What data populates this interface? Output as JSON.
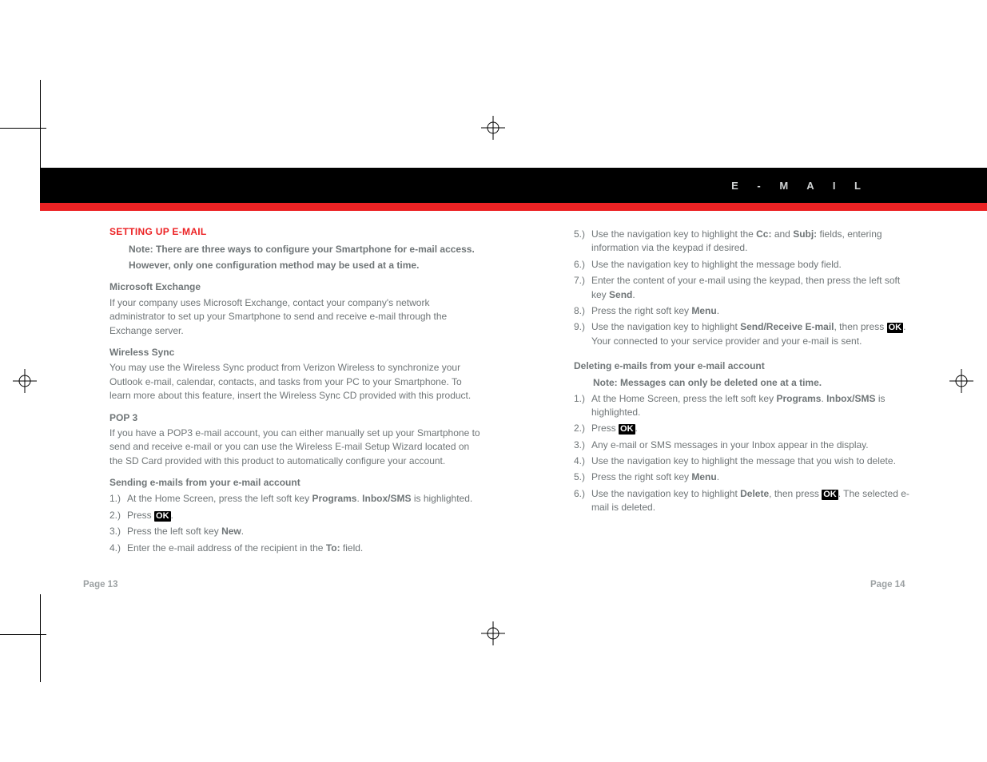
{
  "header": {
    "title": "E - M A I L"
  },
  "left": {
    "title": "SETTING UP E-MAIL",
    "note1": "Note: There are three ways to configure your Smartphone for e-mail access.",
    "note2": "However, only one configuration method may be used at a time.",
    "ms_h": "Microsoft Exchange",
    "ms_p": "If your company uses Microsoft Exchange, contact your company's network administrator to set up your Smartphone to send and receive e-mail through the Exchange server.",
    "ws_h": "Wireless Sync",
    "ws_p": "You may use the Wireless Sync product from Verizon Wireless to synchronize your Outlook e-mail, calendar, contacts, and tasks from your PC to your Smartphone. To learn more about this feature, insert the Wireless Sync CD provided with this product.",
    "pop_h": "POP 3",
    "pop_p": "If you have a POP3 e-mail account, you can either manually set up your Smartphone to send and receive e-mail or you can use the Wireless E-mail Setup Wizard located on the SD Card provided with this product to automatically configure your account.",
    "send_h": "Sending e-mails from your e-mail account",
    "s1n": "1.)",
    "s1a": "At the Home Screen, press the left soft key ",
    "s1b": "Programs",
    "s1c": ". ",
    "s1d": "Inbox/SMS",
    "s1e": " is highlighted.",
    "s2n": "2.)",
    "s2a": "Press ",
    "s2c": ".",
    "s3n": "3.)",
    "s3a": "Press the left soft key ",
    "s3b": "New",
    "s3c": ".",
    "s4n": "4.)",
    "s4a": "Enter the e-mail address of the recipient in the ",
    "s4b": "To:",
    "s4c": " field."
  },
  "right": {
    "s5n": "5.)",
    "s5a": "Use the navigation key to highlight the ",
    "s5b": "Cc:",
    "s5c": " and ",
    "s5d": "Subj:",
    "s5e": " fields, entering information via the keypad if desired.",
    "s6n": "6.)",
    "s6a": "Use the navigation key to highlight the message body field.",
    "s7n": "7.)",
    "s7a": "Enter the content of your e-mail using the keypad, then press the left soft key ",
    "s7b": "Send",
    "s7c": ".",
    "s8n": "8.)",
    "s8a": "Press the right soft key ",
    "s8b": "Menu",
    "s8c": ".",
    "s9n": "9.)",
    "s9a": "Use the navigation key to highlight ",
    "s9b": "Send/Receive E-mail",
    "s9c": ", then press ",
    "s9d": ". Your connected to your service provider and your e-mail is sent.",
    "del_h": "Deleting e-mails from your e-mail account",
    "del_note": "Note: Messages can only be deleted one at a time.",
    "d1n": "1.)",
    "d1a": "At the Home Screen, press the left soft key ",
    "d1b": "Programs",
    "d1c": ". ",
    "d1d": "Inbox/SMS",
    "d1e": " is highlighted.",
    "d2n": "2.)",
    "d2a": "Press ",
    "d2c": ".",
    "d3n": "3.)",
    "d3a": "Any e-mail or SMS messages in your Inbox appear in the display.",
    "d4n": "4.)",
    "d4a": "Use the navigation key to highlight the message that you wish to delete.",
    "d5n": "5.)",
    "d5a": "Press the right soft key ",
    "d5b": "Menu",
    "d5c": ".",
    "d6n": "6.)",
    "d6a": "Use the navigation key to highlight ",
    "d6b": "Delete",
    "d6c": ", then press ",
    "d6d": ". The selected e-mail is deleted."
  },
  "footer": {
    "left": "Page 13",
    "right": "Page 14"
  },
  "ok": "OK"
}
